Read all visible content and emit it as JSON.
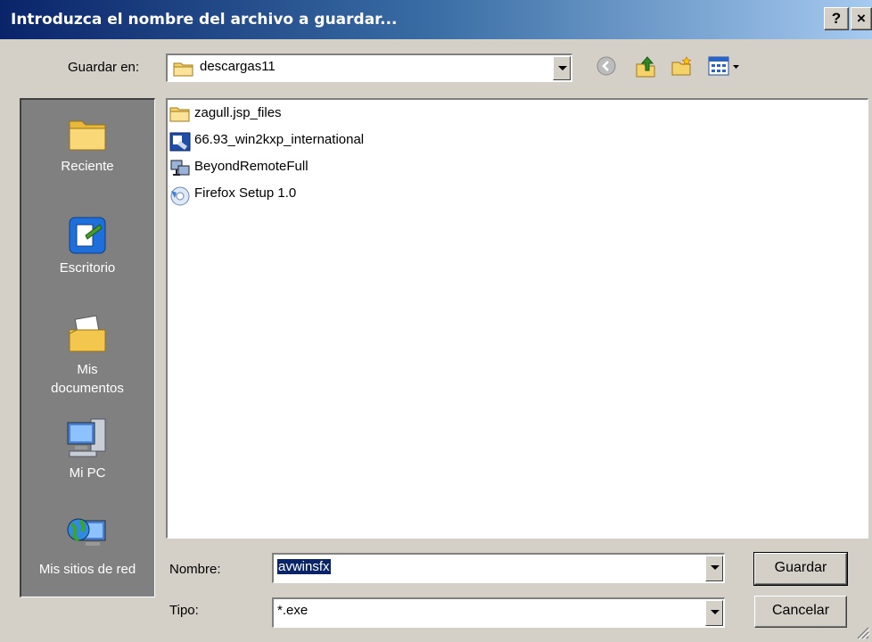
{
  "window": {
    "title": "Introduzca el nombre del archivo a guardar...",
    "help_button": "?",
    "close_button": "×"
  },
  "location": {
    "label": "Guardar en:",
    "value": "descargas11"
  },
  "toolbar": {
    "icons": [
      "back-icon",
      "up-folder-icon",
      "new-folder-icon",
      "view-menu-icon"
    ]
  },
  "places": [
    {
      "label": "Reciente",
      "icon": "recent-folder-icon"
    },
    {
      "label": "Escritorio",
      "icon": "desktop-icon"
    },
    {
      "label": "Mis documentos",
      "icon": "my-documents-icon"
    },
    {
      "label": "Mi PC",
      "icon": "my-computer-icon"
    },
    {
      "label": "Mis sitios de red",
      "icon": "network-places-icon"
    }
  ],
  "files": [
    {
      "name": "zagull.jsp_files",
      "icon": "folder-icon"
    },
    {
      "name": "66.93_win2kxp_international",
      "icon": "installer-icon"
    },
    {
      "name": "BeyondRemoteFull",
      "icon": "network-app-icon"
    },
    {
      "name": "Firefox Setup 1.0",
      "icon": "setup-icon"
    }
  ],
  "filename": {
    "label": "Nombre:",
    "value": "avwinsfx"
  },
  "filetype": {
    "label": "Tipo:",
    "value": "*.exe"
  },
  "buttons": {
    "save": "Guardar",
    "cancel": "Cancelar"
  },
  "colors": {
    "title_start": "#0a246a",
    "title_end": "#a6caf0",
    "dialog_bg": "#d4d0c8",
    "places_bg": "#808080",
    "selection": "#0a246a"
  }
}
